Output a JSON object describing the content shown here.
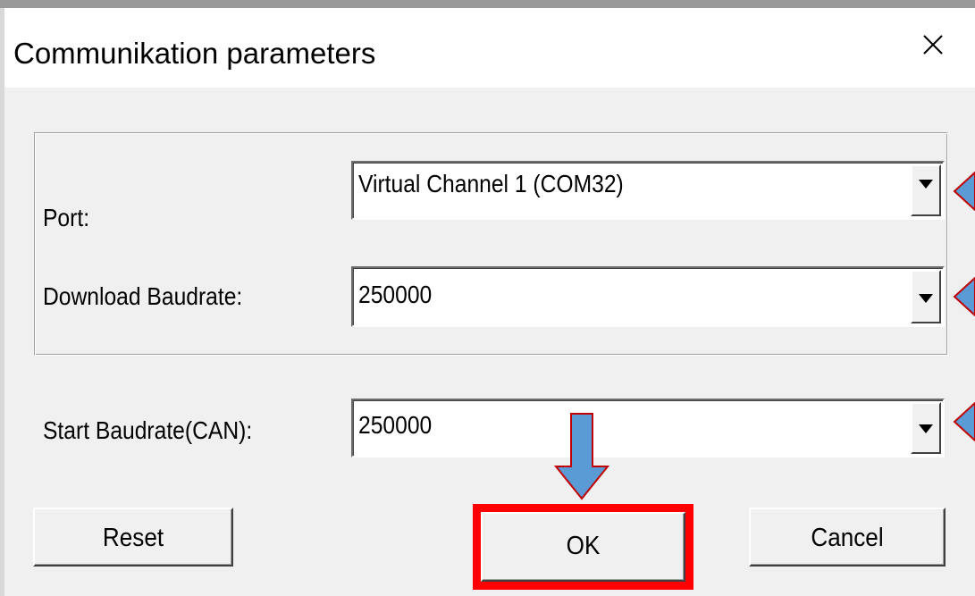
{
  "dialog": {
    "title": "Communikation parameters"
  },
  "fields": {
    "port": {
      "label": "Port:",
      "value": "Virtual Channel 1 (COM32)"
    },
    "download_baudrate": {
      "label": "Download Baudrate:",
      "value": "250000"
    },
    "start_baudrate": {
      "label": "Start Baudrate(CAN):",
      "value": "250000"
    }
  },
  "buttons": {
    "reset": "Reset",
    "ok": "OK",
    "cancel": "Cancel"
  },
  "annotations": {
    "highlight_color": "#ff0000",
    "arrow_fill": "#5b9bd5",
    "arrow_stroke": "#c00000"
  },
  "icons": {
    "close": "close-icon",
    "dropdown": "dropdown-arrow-icon"
  }
}
